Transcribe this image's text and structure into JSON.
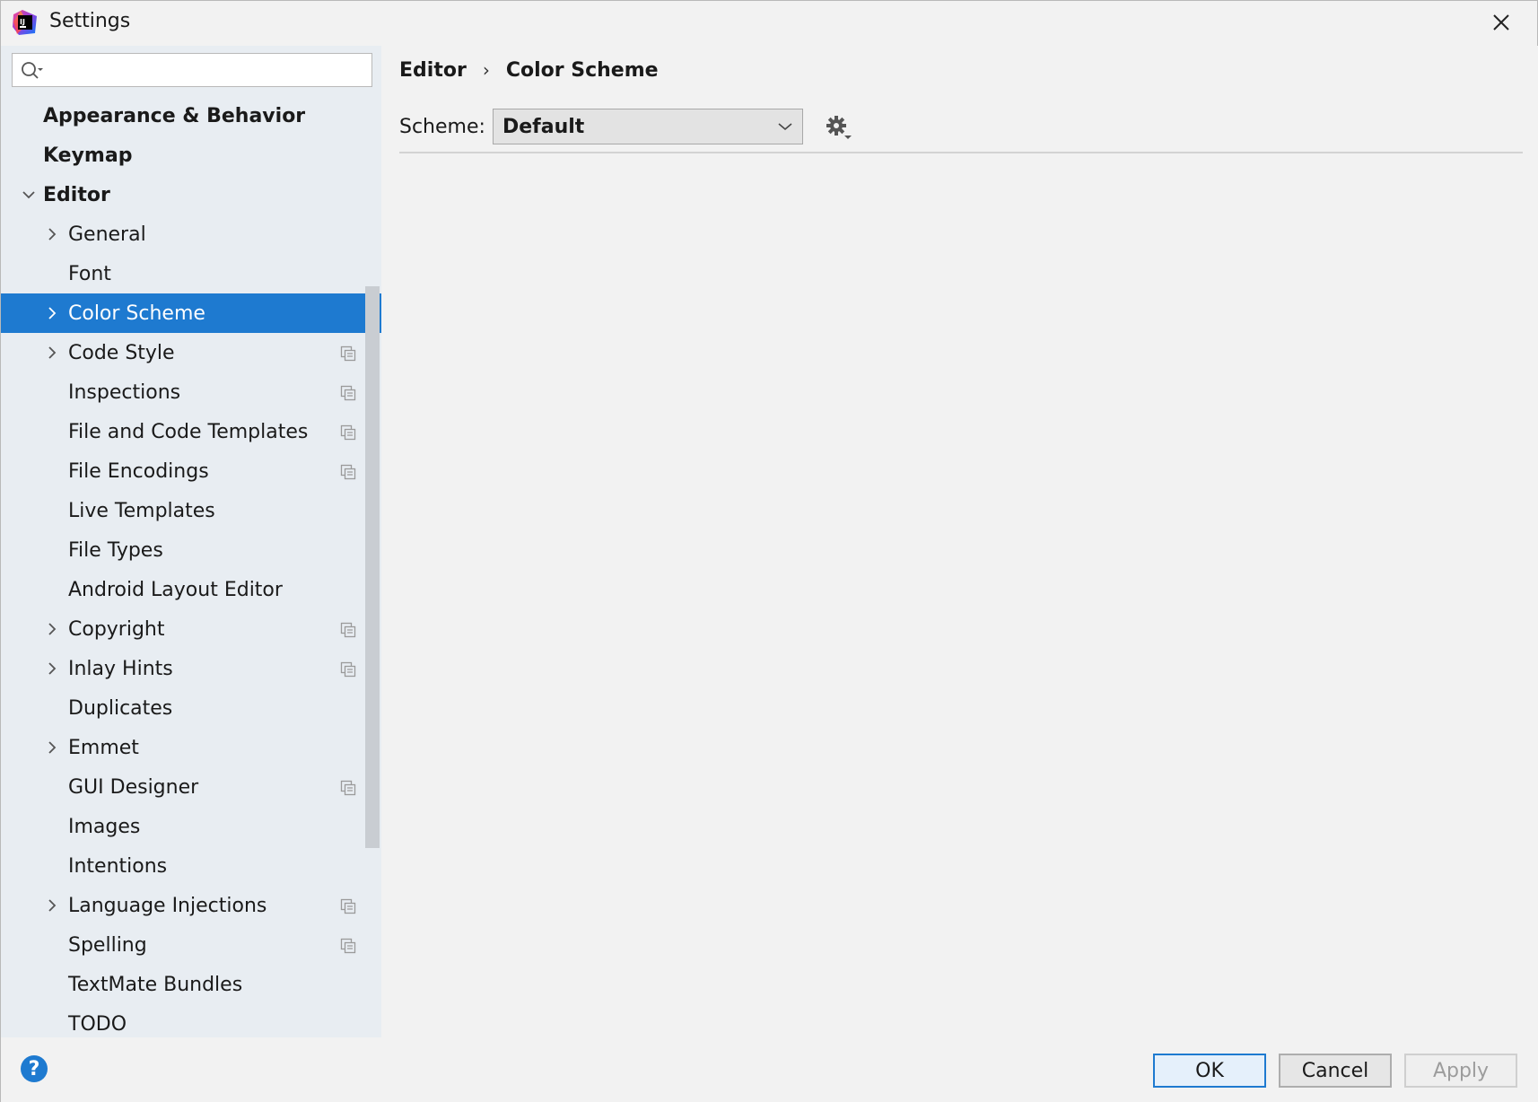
{
  "window": {
    "title": "Settings"
  },
  "search": {
    "value": "",
    "placeholder": ""
  },
  "tree": [
    {
      "label": "Appearance & Behavior",
      "level": 0,
      "bold": true,
      "chevron": "",
      "project": false,
      "selected": false
    },
    {
      "label": "Keymap",
      "level": 0,
      "bold": true,
      "chevron": "",
      "project": false,
      "selected": false
    },
    {
      "label": "Editor",
      "level": 0,
      "bold": true,
      "chevron": "down",
      "project": false,
      "selected": false
    },
    {
      "label": "General",
      "level": 1,
      "bold": false,
      "chevron": "right",
      "project": false,
      "selected": false
    },
    {
      "label": "Font",
      "level": 1,
      "bold": false,
      "chevron": "",
      "project": false,
      "selected": false
    },
    {
      "label": "Color Scheme",
      "level": 1,
      "bold": false,
      "chevron": "right",
      "project": false,
      "selected": true
    },
    {
      "label": "Code Style",
      "level": 1,
      "bold": false,
      "chevron": "right",
      "project": true,
      "selected": false
    },
    {
      "label": "Inspections",
      "level": 1,
      "bold": false,
      "chevron": "",
      "project": true,
      "selected": false
    },
    {
      "label": "File and Code Templates",
      "level": 1,
      "bold": false,
      "chevron": "",
      "project": true,
      "selected": false
    },
    {
      "label": "File Encodings",
      "level": 1,
      "bold": false,
      "chevron": "",
      "project": true,
      "selected": false
    },
    {
      "label": "Live Templates",
      "level": 1,
      "bold": false,
      "chevron": "",
      "project": false,
      "selected": false
    },
    {
      "label": "File Types",
      "level": 1,
      "bold": false,
      "chevron": "",
      "project": false,
      "selected": false
    },
    {
      "label": "Android Layout Editor",
      "level": 1,
      "bold": false,
      "chevron": "",
      "project": false,
      "selected": false
    },
    {
      "label": "Copyright",
      "level": 1,
      "bold": false,
      "chevron": "right",
      "project": true,
      "selected": false
    },
    {
      "label": "Inlay Hints",
      "level": 1,
      "bold": false,
      "chevron": "right",
      "project": true,
      "selected": false
    },
    {
      "label": "Duplicates",
      "level": 1,
      "bold": false,
      "chevron": "",
      "project": false,
      "selected": false
    },
    {
      "label": "Emmet",
      "level": 1,
      "bold": false,
      "chevron": "right",
      "project": false,
      "selected": false
    },
    {
      "label": "GUI Designer",
      "level": 1,
      "bold": false,
      "chevron": "",
      "project": true,
      "selected": false
    },
    {
      "label": "Images",
      "level": 1,
      "bold": false,
      "chevron": "",
      "project": false,
      "selected": false
    },
    {
      "label": "Intentions",
      "level": 1,
      "bold": false,
      "chevron": "",
      "project": false,
      "selected": false
    },
    {
      "label": "Language Injections",
      "level": 1,
      "bold": false,
      "chevron": "right",
      "project": true,
      "selected": false
    },
    {
      "label": "Spelling",
      "level": 1,
      "bold": false,
      "chevron": "",
      "project": true,
      "selected": false
    },
    {
      "label": "TextMate Bundles",
      "level": 1,
      "bold": false,
      "chevron": "",
      "project": false,
      "selected": false
    },
    {
      "label": "TODO",
      "level": 1,
      "bold": false,
      "chevron": "",
      "project": false,
      "selected": false
    }
  ],
  "content": {
    "breadcrumb": [
      "Editor",
      "Color Scheme"
    ],
    "breadcrumb_separator": "›",
    "scheme_label": "Scheme:",
    "scheme_value": "Default"
  },
  "footer": {
    "help": "?",
    "ok": "OK",
    "cancel": "Cancel",
    "apply": "Apply"
  },
  "colors": {
    "accent": "#1e7ad0",
    "sidebar_bg": "#e8edf2",
    "window_bg": "#f2f2f2"
  },
  "icons": {
    "app": "intellij-idea-icon",
    "close": "close-icon",
    "search": "search-icon",
    "gear": "gear-icon",
    "project_level": "project-level-icon",
    "help": "help-icon"
  }
}
